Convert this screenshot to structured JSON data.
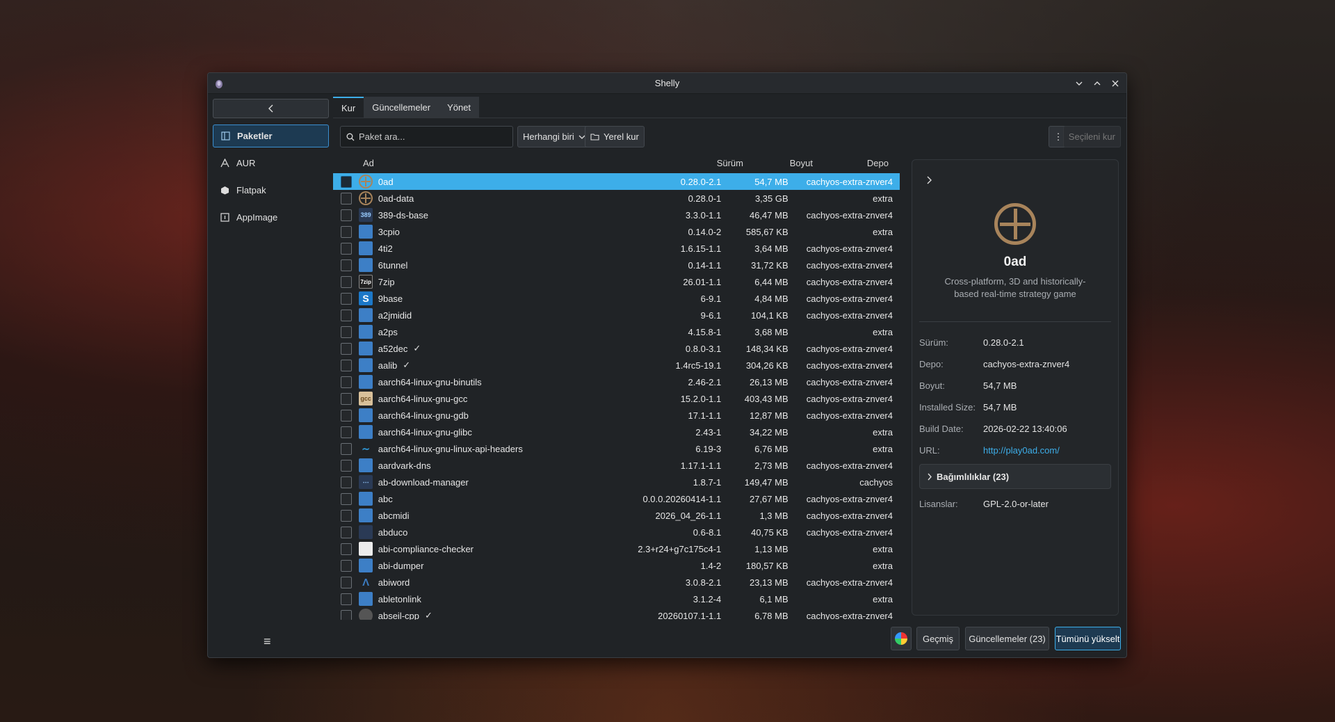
{
  "window": {
    "title": "Shelly"
  },
  "sidebar": {
    "items": [
      {
        "label": "Paketler",
        "icon": "packages-icon"
      },
      {
        "label": "AUR",
        "icon": "aur-icon"
      },
      {
        "label": "Flatpak",
        "icon": "flatpak-icon"
      },
      {
        "label": "AppImage",
        "icon": "appimage-icon"
      }
    ]
  },
  "tabs": [
    {
      "label": "Kur"
    },
    {
      "label": "Güncellemeler"
    },
    {
      "label": "Yönet"
    }
  ],
  "toolbar": {
    "search_placeholder": "Paket ara...",
    "filter_value": "Herhangi biri",
    "local_install": "Yerel kur",
    "install_selected": "Seçileni kur"
  },
  "table": {
    "columns": {
      "name": "Ad",
      "version": "Sürüm",
      "size": "Boyut",
      "repo": "Depo"
    },
    "rows": [
      {
        "name": "0ad",
        "version": "0.28.0-2.1",
        "size": "54,7 MB",
        "repo": "cachyos-extra-znver4",
        "icon": "ring",
        "installed": false,
        "selected": true
      },
      {
        "name": "0ad-data",
        "version": "0.28.0-1",
        "size": "3,35 GB",
        "repo": "extra",
        "icon": "ring",
        "installed": false
      },
      {
        "name": "389-ds-base",
        "version": "3.3.0-1.1",
        "size": "46,47 MB",
        "repo": "cachyos-extra-znver4",
        "icon": "dark",
        "iconText": "389",
        "installed": false
      },
      {
        "name": "3cpio",
        "version": "0.14.0-2",
        "size": "585,67 KB",
        "repo": "extra",
        "icon": "blue",
        "installed": false
      },
      {
        "name": "4ti2",
        "version": "1.6.15-1.1",
        "size": "3,64 MB",
        "repo": "cachyos-extra-znver4",
        "icon": "blue",
        "installed": false
      },
      {
        "name": "6tunnel",
        "version": "0.14-1.1",
        "size": "31,72 KB",
        "repo": "cachyos-extra-znver4",
        "icon": "blue",
        "installed": false
      },
      {
        "name": "7zip",
        "version": "26.01-1.1",
        "size": "6,44 MB",
        "repo": "cachyos-extra-znver4",
        "icon": "zip",
        "iconText": "7zip",
        "installed": false
      },
      {
        "name": "9base",
        "version": "6-9.1",
        "size": "4,84 MB",
        "repo": "cachyos-extra-znver4",
        "icon": "nine",
        "iconText": "S",
        "installed": false
      },
      {
        "name": "a2jmidid",
        "version": "9-6.1",
        "size": "104,1 KB",
        "repo": "cachyos-extra-znver4",
        "icon": "blue",
        "installed": false
      },
      {
        "name": "a2ps",
        "version": "4.15.8-1",
        "size": "3,68 MB",
        "repo": "extra",
        "icon": "blue",
        "installed": false
      },
      {
        "name": "a52dec",
        "version": "0.8.0-3.1",
        "size": "148,34 KB",
        "repo": "cachyos-extra-znver4",
        "icon": "blue",
        "installed": true
      },
      {
        "name": "aalib",
        "version": "1.4rc5-19.1",
        "size": "304,26 KB",
        "repo": "cachyos-extra-znver4",
        "icon": "blue",
        "installed": true
      },
      {
        "name": "aarch64-linux-gnu-binutils",
        "version": "2.46-2.1",
        "size": "26,13 MB",
        "repo": "cachyos-extra-znver4",
        "icon": "blue",
        "installed": false
      },
      {
        "name": "aarch64-linux-gnu-gcc",
        "version": "15.2.0-1.1",
        "size": "403,43 MB",
        "repo": "cachyos-extra-znver4",
        "icon": "beige",
        "iconText": "gcc",
        "installed": false
      },
      {
        "name": "aarch64-linux-gnu-gdb",
        "version": "17.1-1.1",
        "size": "12,87 MB",
        "repo": "cachyos-extra-znver4",
        "icon": "blue",
        "installed": false
      },
      {
        "name": "aarch64-linux-gnu-glibc",
        "version": "2.43-1",
        "size": "34,22 MB",
        "repo": "extra",
        "icon": "blue",
        "installed": false
      },
      {
        "name": "aarch64-linux-gnu-linux-api-headers",
        "version": "6.19-3",
        "size": "6,76 MB",
        "repo": "extra",
        "icon": "wave",
        "iconText": "∼",
        "installed": false
      },
      {
        "name": "aardvark-dns",
        "version": "1.17.1-1.1",
        "size": "2,73 MB",
        "repo": "cachyos-extra-znver4",
        "icon": "blue",
        "installed": false
      },
      {
        "name": "ab-download-manager",
        "version": "1.8.7-1",
        "size": "149,47 MB",
        "repo": "cachyos",
        "icon": "dark",
        "iconText": "⋯",
        "installed": false
      },
      {
        "name": "abc",
        "version": "0.0.0.20260414-1.1",
        "size": "27,67 MB",
        "repo": "cachyos-extra-znver4",
        "icon": "blue",
        "installed": false
      },
      {
        "name": "abcmidi",
        "version": "2026_04_26-1.1",
        "size": "1,3 MB",
        "repo": "cachyos-extra-znver4",
        "icon": "blue",
        "installed": false
      },
      {
        "name": "abduco",
        "version": "0.6-8.1",
        "size": "40,75 KB",
        "repo": "cachyos-extra-znver4",
        "icon": "dark",
        "iconText": "",
        "installed": false
      },
      {
        "name": "abi-compliance-checker",
        "version": "2.3+r24+g7c175c4-1",
        "size": "1,13 MB",
        "repo": "extra",
        "icon": "white",
        "iconText": "",
        "installed": false
      },
      {
        "name": "abi-dumper",
        "version": "1.4-2",
        "size": "180,57 KB",
        "repo": "extra",
        "icon": "blue",
        "installed": false
      },
      {
        "name": "abiword",
        "version": "3.0.8-2.1",
        "size": "23,13 MB",
        "repo": "cachyos-extra-znver4",
        "icon": "abiword",
        "iconText": "Λ",
        "installed": false
      },
      {
        "name": "abletonlink",
        "version": "3.1.2-4",
        "size": "6,1 MB",
        "repo": "extra",
        "icon": "blue",
        "installed": false
      },
      {
        "name": "abseil-cpp",
        "version": "20260107.1-1.1",
        "size": "6,78 MB",
        "repo": "cachyos-extra-znver4",
        "icon": "gray",
        "iconText": "",
        "installed": true
      }
    ]
  },
  "details": {
    "name": "0ad",
    "description": "Cross-platform, 3D and historically-based real-time strategy game",
    "props": [
      {
        "key": "Sürüm:",
        "value": "0.28.0-2.1"
      },
      {
        "key": "Depo:",
        "value": "cachyos-extra-znver4"
      },
      {
        "key": "Boyut:",
        "value": "54,7 MB"
      },
      {
        "key": "Installed Size:",
        "value": "54,7 MB"
      },
      {
        "key": "Build Date:",
        "value": "2026-02-22 13:40:06"
      },
      {
        "key": "URL:",
        "value": "http://play0ad.com/"
      }
    ],
    "dependencies": "Bağımlılıklar (23)",
    "license_key": "Lisanslar:",
    "license_value": "GPL-2.0-or-later"
  },
  "footer": {
    "history": "Geçmiş",
    "updates": "Güncellemeler (23)",
    "upgrade_all": "Tümünü yükselt"
  }
}
